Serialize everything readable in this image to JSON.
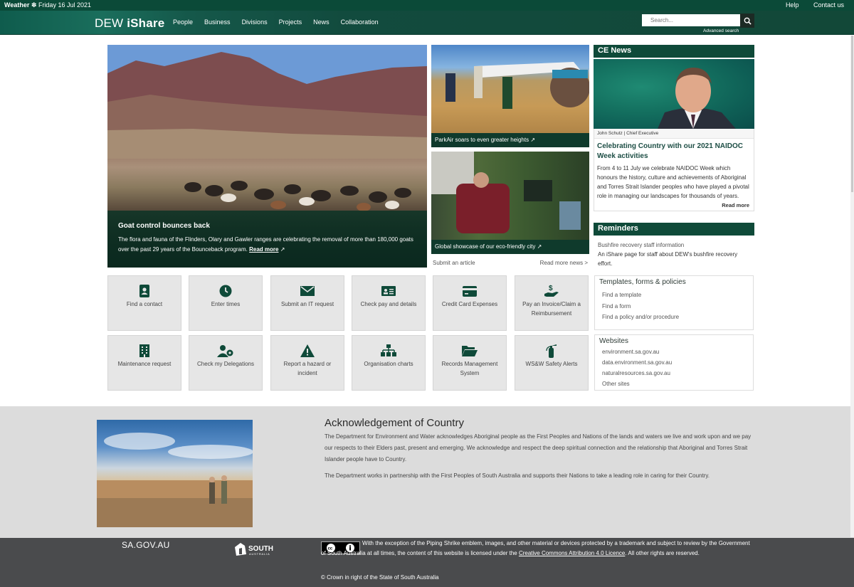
{
  "topbar": {
    "weather_label": "Weather",
    "date": "Friday 16 Jul 2021",
    "links": [
      "Help",
      "Contact us"
    ]
  },
  "header": {
    "brand_prefix": "DEW",
    "brand_name": "iShare",
    "nav": [
      "People",
      "Business",
      "Divisions",
      "Projects",
      "News",
      "Collaboration"
    ],
    "search_placeholder": "Search...",
    "advanced_search": "Advanced search"
  },
  "hero": {
    "title": "Goat control bounces back",
    "text": "The flora and fauna of the Flinders, Olary and Gawler ranges are celebrating the removal of more than 180,000 goats over the past 29 years of the Bounceback program.",
    "read_more": "Read more"
  },
  "news_cards": [
    {
      "caption": "ParkAir soars to even greater heights"
    },
    {
      "caption": "Global showcase of our eco-friendly city"
    }
  ],
  "news_links": {
    "submit": "Submit an article",
    "more": "Read more news >"
  },
  "ce_news": {
    "heading": "CE News",
    "author": "John Schutz | Chief Executive",
    "title": "Celebrating Country with our 2021 NAIDOC Week activities",
    "text": "From 4 to 11 July we celebrate NAIDOC Week which honours the history, culture and achievements of Aboriginal and Torres Strait Islander peoples who have played a pivotal role in managing our landscapes for thousands of years.",
    "read_more": "Read more"
  },
  "reminders": {
    "heading": "Reminders",
    "link": "Bushfire recovery staff information",
    "text": "An iShare page for staff about DEW's bushfire recovery effort."
  },
  "tiles": [
    {
      "label": "Find a contact",
      "icon": "address-book-icon"
    },
    {
      "label": "Enter times",
      "icon": "clock-icon"
    },
    {
      "label": "Submit an IT request",
      "icon": "envelope-icon"
    },
    {
      "label": "Check pay and details",
      "icon": "id-card-icon"
    },
    {
      "label": "Credit Card Expenses",
      "icon": "credit-card-icon"
    },
    {
      "label": "Pay an Invoice/Claim a Reimbursement",
      "icon": "hand-dollar-icon"
    },
    {
      "label": "Maintenance request",
      "icon": "building-icon"
    },
    {
      "label": "Check my Delegations",
      "icon": "user-cog-icon"
    },
    {
      "label": "Report a hazard or incident",
      "icon": "warning-icon"
    },
    {
      "label": "Organisation charts",
      "icon": "sitemap-icon"
    },
    {
      "label": "Records Management System",
      "icon": "folder-open-icon"
    },
    {
      "label": "WS&W Safety Alerts",
      "icon": "fire-extinguisher-icon"
    }
  ],
  "templates": {
    "heading": "Templates, forms & policies",
    "items": [
      "Find a template",
      "Find a form",
      "Find a policy and/or procedure"
    ]
  },
  "websites": {
    "heading": "Websites",
    "items": [
      "environment.sa.gov.au",
      "data.environment.sa.gov.au",
      "naturalresources.sa.gov.au",
      "Other sites"
    ]
  },
  "acknowledgement": {
    "heading": "Acknowledgement of Country",
    "p1": "The Department for Environment and Water acknowledges Aboriginal people as the First Peoples and Nations of the lands and waters we live and work upon and we pay our respects to their Elders past, present and emerging. We acknowledge and respect the deep spiritual connection and the relationship that Aboriginal and Torres Strait Islander people have to Country.",
    "p2": "The Department works in partnership with the First Peoples of South Australia and supports their Nations to take a leading role in caring for their Country."
  },
  "footer": {
    "sagov": "SA.GOV.AU",
    "sa_logo_text": "SOUTH",
    "sa_logo_sub": "AUSTRALIA",
    "license_pre": "With the exception of the Piping Shrike emblem, images, and other material or devices protected by a trademark and subject to review by the Government of South Australia at all times, the content of this website is licensed under the ",
    "license_link": "Creative Commons Attribution 4.0 Licence",
    "license_post": ". All other rights are reserved.",
    "copyright": "© Crown in right of the State of South Australia"
  },
  "colors": {
    "brand_green": "#0f4a39",
    "tile_bg": "#e6e6e6",
    "footer_bg": "#4a4b4d",
    "ack_bg": "#dcdcdc"
  }
}
